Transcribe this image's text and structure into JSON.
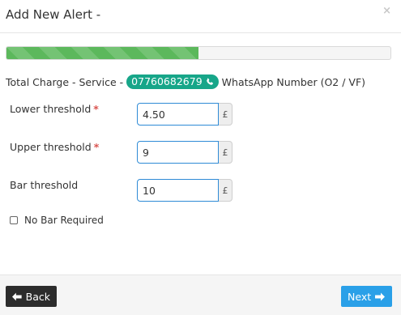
{
  "header": {
    "title": "Add New Alert -",
    "close_glyph": "×"
  },
  "progress": {
    "percent": 50,
    "color": "#5cb85c"
  },
  "description": {
    "prefix": "Total Charge - Service -",
    "phone": "07760682679",
    "suffix": "WhatsApp Number (O2 / VF)"
  },
  "fields": {
    "lower": {
      "label": "Lower threshold",
      "required": "*",
      "value": "4.50",
      "unit": "£"
    },
    "upper": {
      "label": "Upper threshold",
      "required": "*",
      "value": "9",
      "unit": "£"
    },
    "bar": {
      "label": "Bar threshold",
      "value": "10",
      "unit": "£"
    }
  },
  "no_bar": {
    "label": "No Bar Required",
    "checked": false
  },
  "footer": {
    "back_label": "Back",
    "next_label": "Next"
  },
  "colors": {
    "accent": "#2aa0e8",
    "badge": "#17a689",
    "required": "#d9534f",
    "back": "#2c2c2c"
  }
}
